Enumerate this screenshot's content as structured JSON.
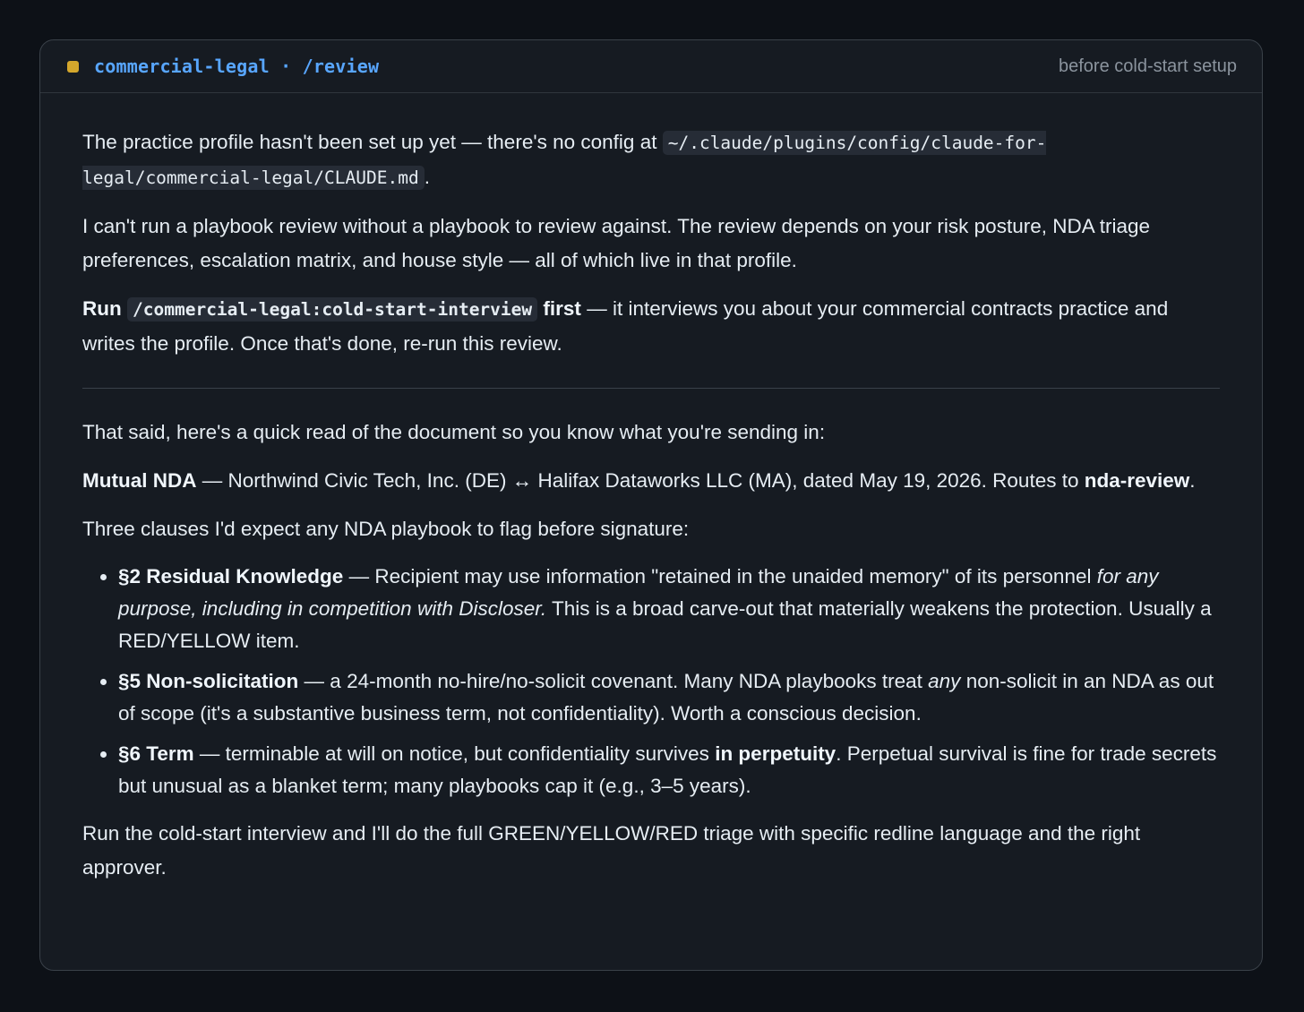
{
  "header": {
    "title": "commercial-legal · /review",
    "subtitle": "before cold-start setup",
    "status_color": "#d4a72c",
    "status_icon": "status-square-icon"
  },
  "message": {
    "intro": {
      "text": "The practice profile hasn't been set up yet — there's no config at",
      "path": "~/.claude/plugins/config/claude-for-legal/commercial-legal/CLAUDE.md",
      "end": "."
    },
    "explanation": "I can't run a playbook review without a playbook to review against. The review depends on your risk posture, NDA triage preferences, escalation matrix, and house style — all of which live in that profile.",
    "instruction": {
      "run": "Run",
      "command": "/commercial-legal:cold-start-interview",
      "first": "first",
      "rest": "— it interviews you about your commercial contracts practice and writes the profile. Once that's done, re-run this review."
    },
    "quick_read_intro": "That said, here's a quick read of the document so you know what you're sending in:",
    "document": {
      "type": "Mutual NDA",
      "parties": "— Northwind Civic Tech, Inc. (DE) ↔ Halifax Dataworks LLC (MA), dated May 19, 2026. Routes to",
      "route": "nda-review",
      "end": "."
    },
    "clauses_intro": "Three clauses I'd expect any NDA playbook to flag before signature:",
    "clauses": [
      {
        "title": "§2 Residual Knowledge",
        "text_before": "— Recipient may use information \"retained in the unaided memory\" of its personnel",
        "emphasis": "for any purpose, including in competition with Discloser.",
        "text_after": "This is a broad carve-out that materially weakens the protection. Usually a RED/YELLOW item."
      },
      {
        "title": "§5 Non-solicitation",
        "text_before": "— a 24-month no-hire/no-solicit covenant. Many NDA playbooks treat",
        "emphasis": "any",
        "text_after": "non-solicit in an NDA as out of scope (it's a substantive business term, not confidentiality). Worth a conscious decision."
      },
      {
        "title": "§6 Term",
        "text_before": "— terminable at will on notice, but confidentiality survives",
        "strong": "in perpetuity",
        "text_after": ". Perpetual survival is fine for trade secrets but unusual as a blanket term; many playbooks cap it (e.g., 3–5 years)."
      }
    ],
    "closing": "Run the cold-start interview and I'll do the full GREEN/YELLOW/RED triage with specific redline language and the right approver."
  }
}
